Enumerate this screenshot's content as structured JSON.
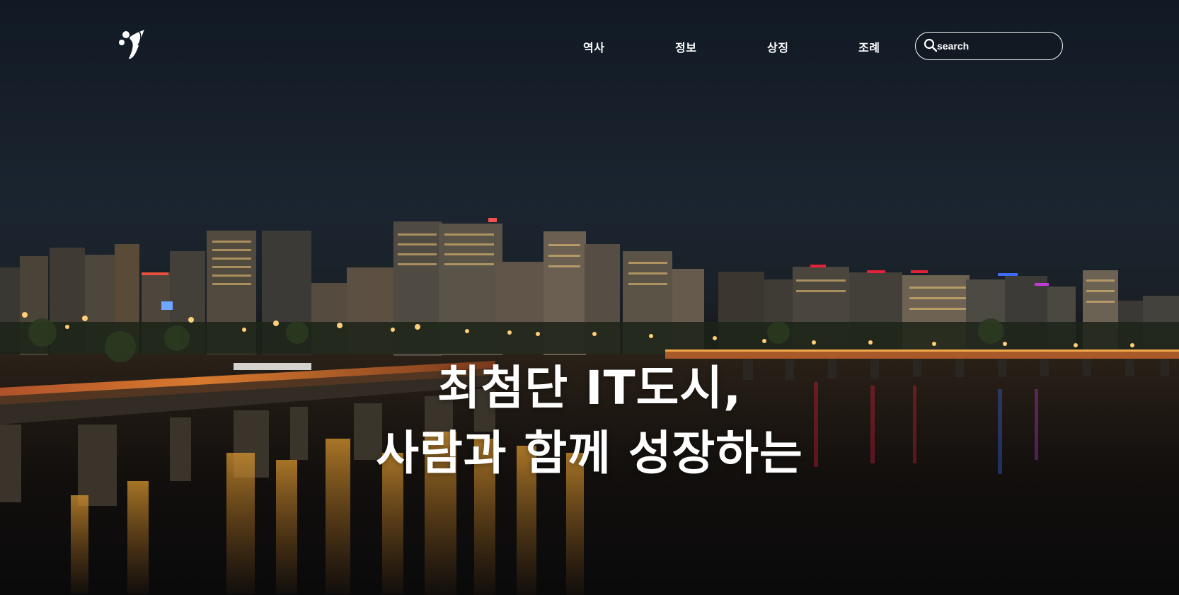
{
  "header": {
    "nav": [
      {
        "label": "역사"
      },
      {
        "label": "정보"
      },
      {
        "label": "상징"
      },
      {
        "label": "조례"
      }
    ],
    "search": {
      "placeholder": "search"
    }
  },
  "hero": {
    "headline_line1": "최첨단 IT도시,",
    "headline_line2": "사람과 함께 성장하는"
  },
  "colors": {
    "text": "#ffffff",
    "sky": "#17202b",
    "lights": "#f2a23c"
  }
}
